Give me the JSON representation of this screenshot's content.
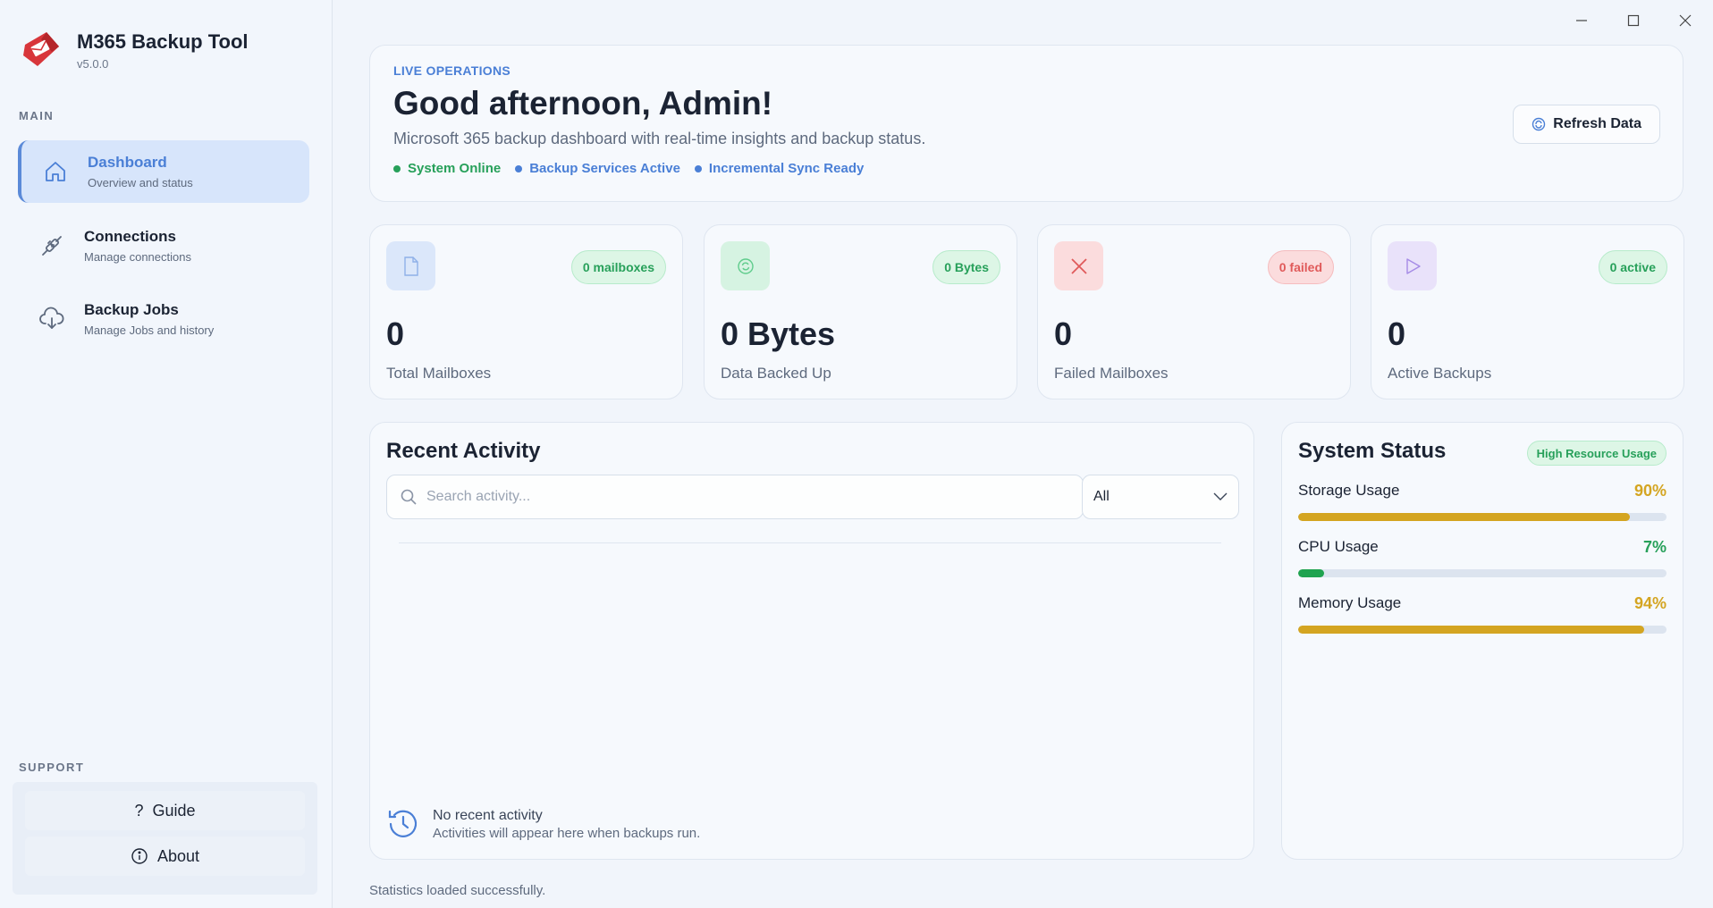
{
  "app": {
    "title": "M365 Backup Tool",
    "version": "v5.0.0"
  },
  "sidebar": {
    "main_label": "MAIN",
    "items": [
      {
        "title": "Dashboard",
        "subtitle": "Overview and status",
        "icon": "home-icon",
        "active": true
      },
      {
        "title": "Connections",
        "subtitle": "Manage connections",
        "icon": "plug-icon",
        "active": false
      },
      {
        "title": "Backup Jobs",
        "subtitle": "Manage Jobs and history",
        "icon": "cloud-download-icon",
        "active": false
      }
    ],
    "support_label": "SUPPORT",
    "support": [
      {
        "label": "Guide",
        "icon": "question-icon"
      },
      {
        "label": "About",
        "icon": "info-icon"
      }
    ]
  },
  "hero": {
    "eyebrow": "LIVE OPERATIONS",
    "greeting": "Good afternoon, Admin!",
    "subtitle": "Microsoft 365 backup dashboard with real-time insights and backup status.",
    "statuses": [
      {
        "label": "System Online",
        "color": "#27a05a"
      },
      {
        "label": "Backup Services Active",
        "color": "#4a7fd6"
      },
      {
        "label": "Incremental Sync Ready",
        "color": "#4a7fd6"
      }
    ],
    "refresh_label": "Refresh Data"
  },
  "stats": [
    {
      "value": "0",
      "label": "Total Mailboxes",
      "badge": "0 mailboxes",
      "icon": "document-icon",
      "accent": "#7fa6e6"
    },
    {
      "value": "0 Bytes",
      "label": "Data Backed Up",
      "badge": "0 Bytes",
      "icon": "sync-icon",
      "accent": "#3fc07a"
    },
    {
      "value": "0",
      "label": "Failed Mailboxes",
      "badge": "0 failed",
      "icon": "x-icon",
      "accent": "#e05a5a"
    },
    {
      "value": "0",
      "label": "Active Backups",
      "badge": "0 active",
      "icon": "play-icon",
      "accent": "#a58be6"
    }
  ],
  "activity": {
    "title": "Recent Activity",
    "search_placeholder": "Search activity...",
    "filter_value": "All",
    "empty_title": "No recent activity",
    "empty_subtitle": "Activities will appear here when backups run."
  },
  "system_status": {
    "title": "System Status",
    "badge": "High Resource Usage",
    "metrics": [
      {
        "label": "Storage Usage",
        "display": "90%",
        "value": 0.9,
        "color": "#d4a521",
        "text_color": "#d4a521"
      },
      {
        "label": "CPU Usage",
        "display": "7%",
        "value": 0.07,
        "color": "#1fa34f",
        "text_color": "#27a05a"
      },
      {
        "label": "Memory Usage",
        "display": "94%",
        "value": 0.94,
        "color": "#d4a521",
        "text_color": "#d4a521"
      }
    ]
  },
  "footer": {
    "status": "Statistics loaded successfully."
  }
}
